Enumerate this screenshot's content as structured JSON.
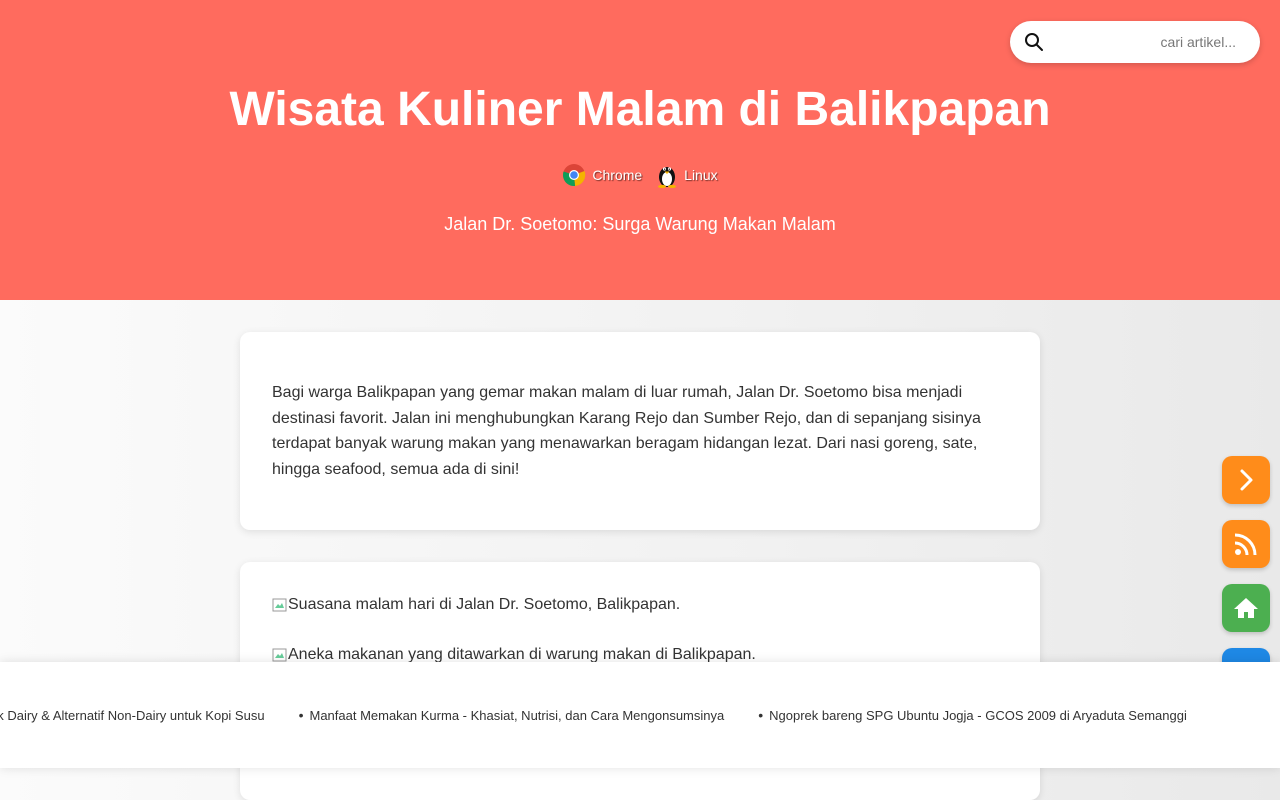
{
  "search": {
    "placeholder": "cari artikel..."
  },
  "header": {
    "title": "Wisata Kuliner Malam di Balikpapan",
    "badges": [
      {
        "label": "Chrome",
        "icon": "chrome-icon"
      },
      {
        "label": "Linux",
        "icon": "tux-icon"
      }
    ],
    "subtitle": "Jalan Dr. Soetomo: Surga Warung Makan Malam"
  },
  "article": {
    "intro": "Bagi warga Balikpapan yang gemar makan malam di luar rumah, Jalan Dr. Soetomo bisa menjadi destinasi favorit. Jalan ini menghubungkan Karang Rejo dan Sumber Rejo, dan di sepanjang sisinya terdapat banyak warung makan yang menawarkan beragam hidangan lezat. Dari nasi goreng, sate, hingga seafood, semua ada di sini!",
    "images": [
      {
        "alt": "Suasana malam hari di Jalan Dr. Soetomo, Balikpapan."
      },
      {
        "alt": "Aneka makanan yang ditawarkan di warung makan di Balikpapan."
      }
    ]
  },
  "side_buttons": [
    {
      "name": "next-button",
      "icon": "chevron-right-icon",
      "color": "#ff8c1a"
    },
    {
      "name": "rss-button",
      "icon": "rss-icon",
      "color": "#ff8c1a"
    },
    {
      "name": "home-button",
      "icon": "home-icon",
      "color": "#4caf50"
    },
    {
      "name": "extra-button",
      "icon": "bookmark-icon",
      "color": "#1e88e5"
    }
  ],
  "ticker": {
    "items": [
      "uk Dairy & Alternatif Non-Dairy untuk Kopi Susu",
      "Manfaat Memakan Kurma - Khasiat, Nutrisi, dan Cara Mengonsumsinya",
      "Ngoprek bareng SPG Ubuntu Jogja - GCOS 2009 di Aryaduta Semanggi"
    ]
  },
  "colors": {
    "hero": "#ff6b5e",
    "accent_orange": "#ff8c1a",
    "accent_green": "#4caf50",
    "accent_blue": "#1e88e5"
  }
}
